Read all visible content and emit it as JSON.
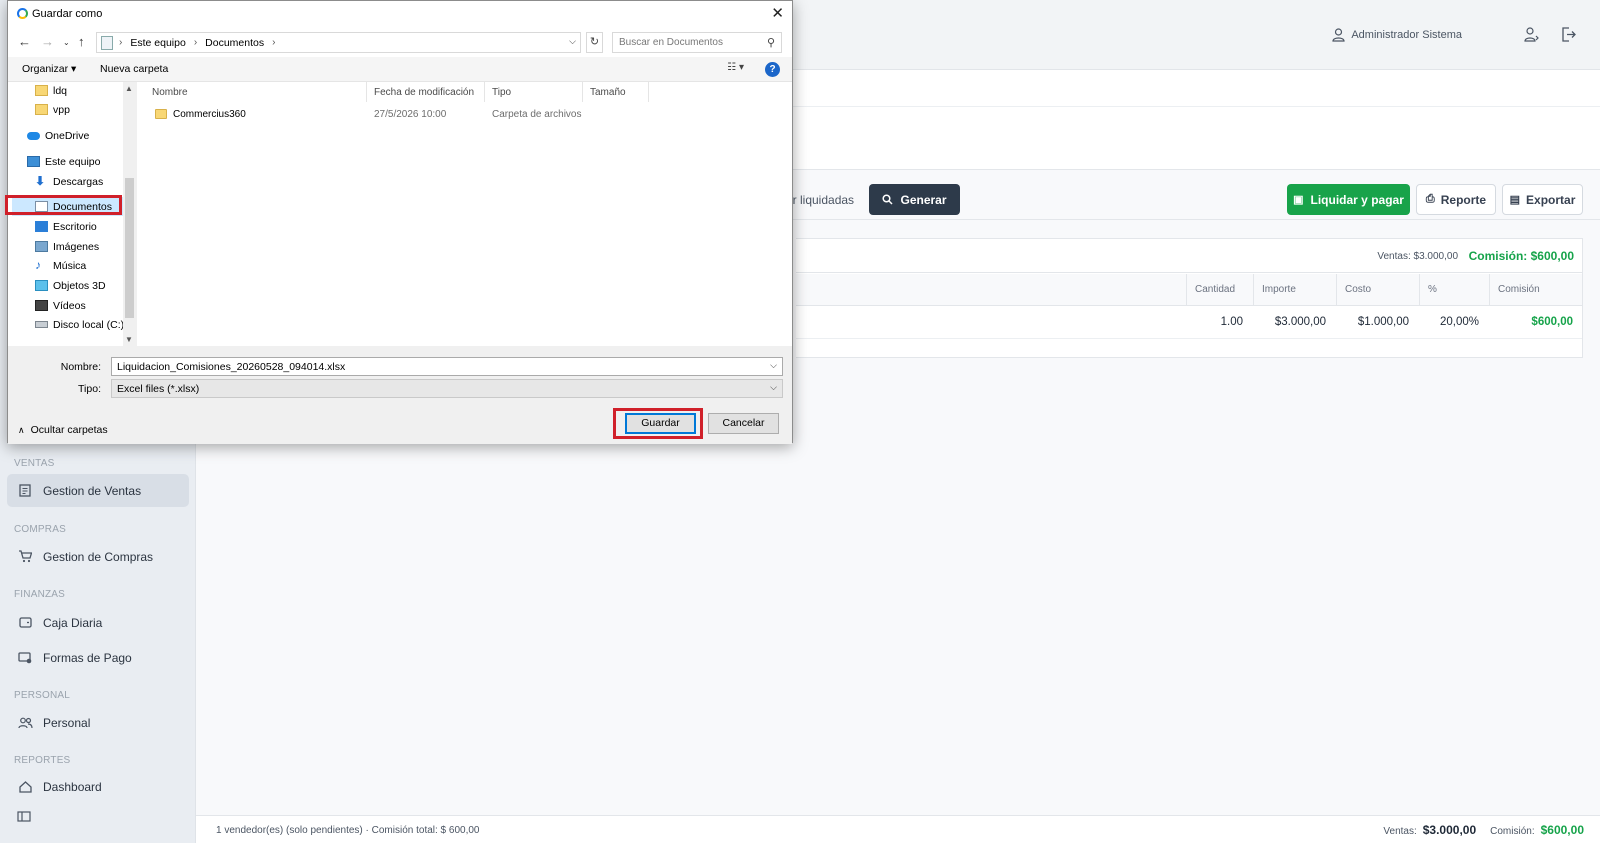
{
  "app": {
    "user": "Administrador Sistema",
    "sidebar": {
      "groups": [
        {
          "label": "VENTAS",
          "items": [
            {
              "label": "Gestion de Ventas",
              "icon": "receipt-icon",
              "active": true
            }
          ]
        },
        {
          "label": "COMPRAS",
          "items": [
            {
              "label": "Gestion de Compras",
              "icon": "cart-icon"
            }
          ]
        },
        {
          "label": "FINANZAS",
          "items": [
            {
              "label": "Caja Diaria",
              "icon": "wallet-icon"
            },
            {
              "label": "Formas de Pago",
              "icon": "card-icon"
            }
          ]
        },
        {
          "label": "PERSONAL",
          "items": [
            {
              "label": "Personal",
              "icon": "users-icon"
            }
          ]
        },
        {
          "label": "REPORTES",
          "items": [
            {
              "label": "Dashboard",
              "icon": "home-icon"
            }
          ]
        }
      ]
    },
    "toolbar": {
      "include_settled_partial": "ir liquidadas",
      "generate": "Generar",
      "settle_and_pay": "Liquidar y pagar",
      "report": "Reporte",
      "export": "Exportar"
    },
    "summary": {
      "ventas": "Ventas: $3.000,00",
      "comision": "Comisión: $600,00"
    },
    "table": {
      "columns": [
        "Cantidad",
        "Importe",
        "Costo",
        "%",
        "Comisión"
      ],
      "rows": [
        {
          "cantidad": "1.00",
          "importe": "$3.000,00",
          "costo": "$1.000,00",
          "pct": "20,00%",
          "comision": "$600,00"
        }
      ]
    },
    "footer": {
      "left": "1 vendedor(es) (solo pendientes) · Comisión total: $ 600,00",
      "ventas_label": "Ventas:",
      "ventas_value": "$3.000,00",
      "comision_label": "Comisión:",
      "comision_value": "$600,00"
    },
    "colors": {
      "primary_dark": "#2d3a4a",
      "success": "#18a34a"
    }
  },
  "dialog": {
    "title": "Guardar como",
    "address": [
      "Este equipo",
      "Documentos"
    ],
    "search_placeholder": "Buscar en Documentos",
    "commands": {
      "organize": "Organizar",
      "new_folder": "Nueva carpeta"
    },
    "tree": [
      {
        "label": "ldq",
        "icon": "folder-icon"
      },
      {
        "label": "vpp",
        "icon": "folder-icon"
      },
      {
        "label": "OneDrive",
        "icon": "cloud-icon"
      },
      {
        "label": "Este equipo",
        "icon": "computer-icon"
      },
      {
        "label": "Descargas",
        "icon": "download-icon"
      },
      {
        "label": "Documentos",
        "icon": "document-icon",
        "selected": true
      },
      {
        "label": "Escritorio",
        "icon": "desktop-icon"
      },
      {
        "label": "Imágenes",
        "icon": "image-icon"
      },
      {
        "label": "Música",
        "icon": "music-icon"
      },
      {
        "label": "Objetos 3D",
        "icon": "cube-icon"
      },
      {
        "label": "Vídeos",
        "icon": "video-icon"
      },
      {
        "label": "Disco local (C:)",
        "icon": "drive-icon"
      }
    ],
    "columns": [
      "Nombre",
      "Fecha de modificación",
      "Tipo",
      "Tamaño"
    ],
    "files": [
      {
        "name": "Commercius360",
        "modified": "27/5/2026 10:00",
        "type": "Carpeta de archivos",
        "size": ""
      }
    ],
    "name_label": "Nombre:",
    "filename": "Liquidacion_Comisiones_20260528_094014.xlsx",
    "type_label": "Tipo:",
    "filetype": "Excel files (*.xlsx)",
    "hide_folders": "Ocultar carpetas",
    "save": "Guardar",
    "cancel": "Cancelar"
  }
}
